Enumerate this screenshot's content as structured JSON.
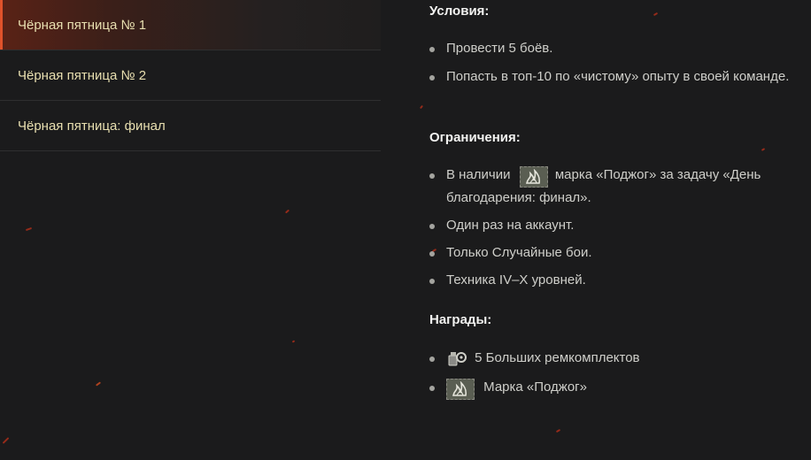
{
  "sidebar": {
    "items": [
      {
        "label": "Чёрная пятница № 1"
      },
      {
        "label": "Чёрная пятница № 2"
      },
      {
        "label": "Чёрная пятница: финал"
      }
    ]
  },
  "content": {
    "conditions": {
      "title": "Условия:",
      "items": [
        "Провести 5 боёв.",
        "Попасть в топ-10 по «чистому» опыту в своей команде."
      ]
    },
    "restrictions": {
      "title": "Ограничения:",
      "item1_prefix": "В наличии",
      "item1_suffix": "марка «Поджог» за задачу «День благодарения: финал».",
      "items": [
        "Один раз на аккаунт.",
        "Только Случайные бои.",
        "Техника IV–X уровней."
      ]
    },
    "rewards": {
      "title": "Награды:",
      "items": [
        {
          "icon": "repair-kit-icon",
          "label": "5 Больших ремкомплектов"
        },
        {
          "icon": "arson-stamp-icon",
          "label": "Марка «Поджог»"
        }
      ]
    }
  },
  "colors": {
    "background": "#1b1b1c",
    "accent": "#e0522a",
    "sidebar_text": "#e8dfb0",
    "heading_text": "#f2f2f0"
  }
}
